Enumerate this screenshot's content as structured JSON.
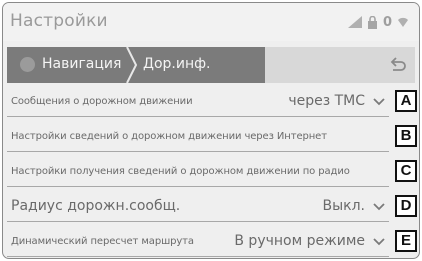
{
  "header": {
    "title": "Настройки",
    "status_number": "0"
  },
  "nav": {
    "crumb_1": "Навигация",
    "crumb_2": "Дор.инф."
  },
  "settings": [
    {
      "label": "Сообщения о дорожном движении",
      "value": "через TMC",
      "callout": "A"
    },
    {
      "label": "Настройки сведений о дорожном движении через Интернет",
      "value": "",
      "callout": "B"
    },
    {
      "label": "Настройки получения сведений о дорожном движении по радио",
      "value": "",
      "callout": "C"
    },
    {
      "label": "Радиус дорожн.сообщ.",
      "value": "Выкл.",
      "callout": "D"
    },
    {
      "label": "Динамический пересчет маршрута",
      "value": "В ручном режиме",
      "callout": "E"
    }
  ]
}
